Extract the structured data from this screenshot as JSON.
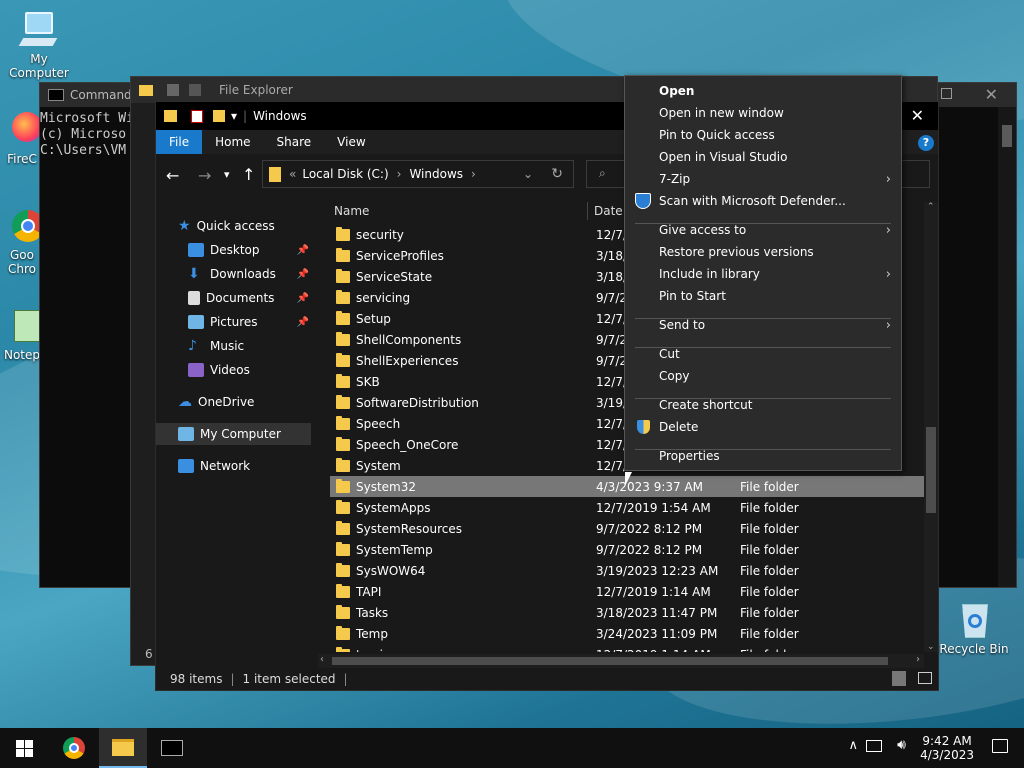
{
  "desktop": {
    "icons": [
      {
        "label": "My Computer"
      },
      {
        "label": "FireC"
      },
      {
        "label": "Goo\nChro"
      },
      {
        "label": "Notep"
      },
      {
        "label": "Recycle Bin"
      }
    ]
  },
  "cmd": {
    "title": "Command",
    "lines": "Microsoft Wi\n(c) Microso\nC:\\Users\\VM",
    "footer": "6 i"
  },
  "explorer_back": {
    "title": "File Explorer"
  },
  "explorer": {
    "title": "Windows",
    "ribbon_tabs": [
      "File",
      "Home",
      "Share",
      "View"
    ],
    "address": {
      "prefix": "«",
      "crumbs": [
        "Local Disk (C:)",
        "Windows"
      ]
    },
    "columns": {
      "name": "Name",
      "date": "Date m"
    },
    "nav": [
      {
        "label": "Quick access",
        "icon": "star-icon",
        "pinned": false
      },
      {
        "label": "Desktop",
        "icon": "desktop-icon",
        "pinned": true
      },
      {
        "label": "Downloads",
        "icon": "download-icon",
        "pinned": true
      },
      {
        "label": "Documents",
        "icon": "documents-icon",
        "pinned": true
      },
      {
        "label": "Pictures",
        "icon": "pictures-icon",
        "pinned": true
      },
      {
        "label": "Music",
        "icon": "music-icon",
        "pinned": false
      },
      {
        "label": "Videos",
        "icon": "videos-icon",
        "pinned": false
      },
      {
        "label": "OneDrive",
        "icon": "cloud-icon",
        "pinned": false
      },
      {
        "label": "My Computer",
        "icon": "computer-icon",
        "pinned": false
      },
      {
        "label": "Network",
        "icon": "network-icon",
        "pinned": false
      }
    ],
    "files": [
      {
        "name": "security",
        "date": "12/7/",
        "type": ""
      },
      {
        "name": "ServiceProfiles",
        "date": "3/18/",
        "type": ""
      },
      {
        "name": "ServiceState",
        "date": "3/18/",
        "type": ""
      },
      {
        "name": "servicing",
        "date": "9/7/2",
        "type": ""
      },
      {
        "name": "Setup",
        "date": "12/7/",
        "type": ""
      },
      {
        "name": "ShellComponents",
        "date": "9/7/2",
        "type": ""
      },
      {
        "name": "ShellExperiences",
        "date": "9/7/2",
        "type": ""
      },
      {
        "name": "SKB",
        "date": "12/7/",
        "type": ""
      },
      {
        "name": "SoftwareDistribution",
        "date": "3/19/",
        "type": ""
      },
      {
        "name": "Speech",
        "date": "12/7/",
        "type": ""
      },
      {
        "name": "Speech_OneCore",
        "date": "12/7/",
        "type": ""
      },
      {
        "name": "System",
        "date": "12/7/",
        "type": ""
      },
      {
        "name": "System32",
        "date": "4/3/2023 9:37 AM",
        "type": "File folder",
        "selected": true
      },
      {
        "name": "SystemApps",
        "date": "12/7/2019 1:54 AM",
        "type": "File folder"
      },
      {
        "name": "SystemResources",
        "date": "9/7/2022 8:12 PM",
        "type": "File folder"
      },
      {
        "name": "SystemTemp",
        "date": "9/7/2022 8:12 PM",
        "type": "File folder"
      },
      {
        "name": "SysWOW64",
        "date": "3/19/2023 12:23 AM",
        "type": "File folder"
      },
      {
        "name": "TAPI",
        "date": "12/7/2019 1:14 AM",
        "type": "File folder"
      },
      {
        "name": "Tasks",
        "date": "3/18/2023 11:47 PM",
        "type": "File folder"
      },
      {
        "name": "Temp",
        "date": "3/24/2023 11:09 PM",
        "type": "File folder"
      },
      {
        "name": "tracing",
        "date": "12/7/2019 1:14 AM",
        "type": "File folder"
      }
    ],
    "status": {
      "items": "98 items",
      "selected": "1 item selected"
    }
  },
  "context_menu": {
    "items": [
      {
        "label": "Open",
        "bold": true
      },
      {
        "label": "Open in new window"
      },
      {
        "label": "Pin to Quick access"
      },
      {
        "label": "Open in Visual Studio"
      },
      {
        "label": "7-Zip",
        "submenu": true
      },
      {
        "label": "Scan with Microsoft Defender...",
        "icon": "defender-shield-icon"
      },
      {
        "label": "Give access to",
        "submenu": true
      },
      {
        "label": "Restore previous versions"
      },
      {
        "label": "Include in library",
        "submenu": true
      },
      {
        "label": "Pin to Start"
      },
      {
        "label": "Send to",
        "submenu": true
      },
      {
        "label": "Cut"
      },
      {
        "label": "Copy"
      },
      {
        "label": "Create shortcut"
      },
      {
        "label": "Delete",
        "icon": "uac-shield-icon"
      },
      {
        "label": "Properties"
      }
    ]
  },
  "taskbar": {
    "time": "9:42 AM",
    "date": "4/3/2023",
    "apps": [
      "start-icon",
      "chrome-icon",
      "file-explorer-icon",
      "terminal-icon"
    ]
  }
}
